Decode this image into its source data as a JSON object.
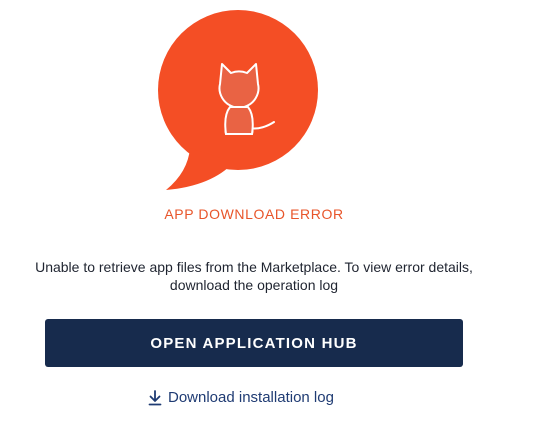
{
  "error": {
    "title": "APP DOWNLOAD ERROR",
    "message": "Unable to retrieve app files from the Marketplace. To view error details, download the operation log",
    "illustration_icon": "cat-speech-bubble-icon"
  },
  "actions": {
    "primary_label": "OPEN APPLICATION HUB",
    "link_label": "Download installation log",
    "link_icon": "download-icon"
  },
  "colors": {
    "accent": "#f44e25",
    "title": "#e8552a",
    "button": "#172b4d",
    "link": "#1f3b73"
  }
}
